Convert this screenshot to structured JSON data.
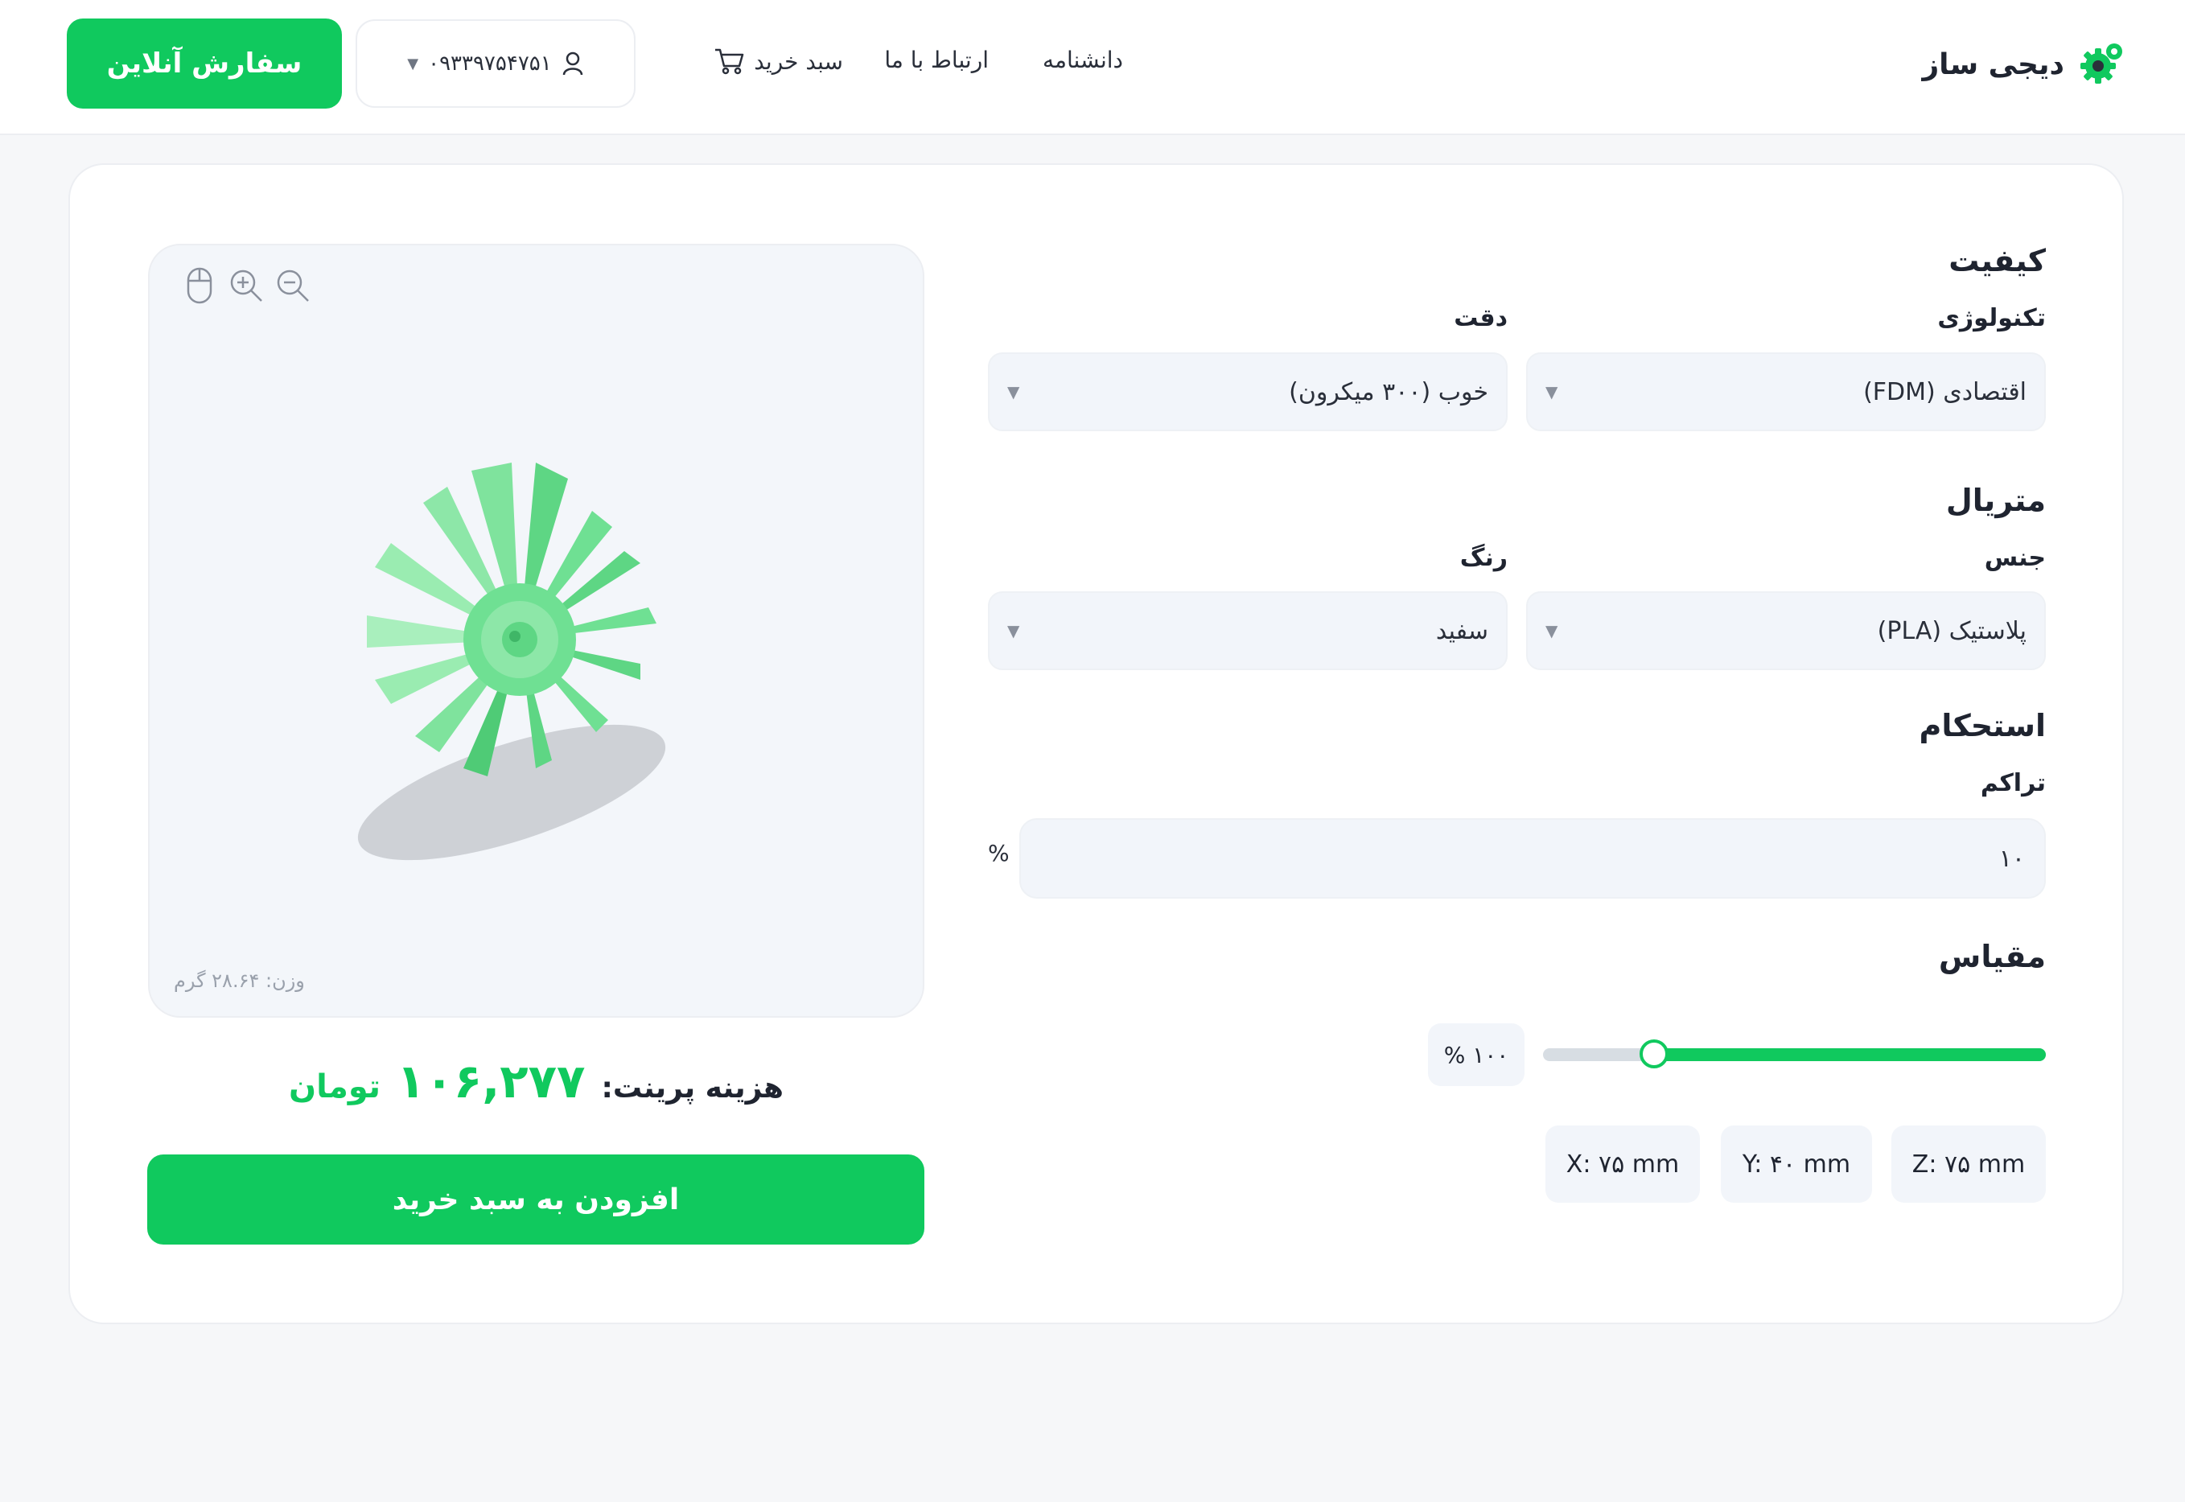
{
  "header": {
    "logo_text": "دیجی ساز",
    "nav": {
      "knowledge": "دانشنامه",
      "contact": "ارتباط با ما",
      "cart": "سبد خرید"
    },
    "phone": "۰۹۳۳۹۷۵۴۷۵۱",
    "order_button": "سفارش آنلاین"
  },
  "colors": {
    "brand_green": "#10c95e",
    "panel_bg": "#f3f6fa",
    "text_dark": "#1f2430"
  },
  "preview": {
    "tools": [
      "mouse-icon",
      "zoom-in-icon",
      "zoom-out-icon"
    ],
    "weight_text": "وزن: ۲۸.۶۴ گرم"
  },
  "price": {
    "label": "هزینه پرینت:",
    "value": "۱۰۶,۲۷۷",
    "unit": "تومان"
  },
  "add_to_cart": "افزودن به سبد خرید",
  "form": {
    "quality": {
      "title": "کیفیت",
      "technology_label": "تکنولوژی",
      "technology_value": "اقتصادی (FDM)",
      "precision_label": "دقت",
      "precision_value": "خوب (۳۰۰ میکرون)"
    },
    "material": {
      "title": "متریال",
      "type_label": "جنس",
      "type_value": "پلاستیک (PLA)",
      "color_label": "رنگ",
      "color_value": "سفید"
    },
    "strength": {
      "title": "استحکام",
      "density_label": "تراکم",
      "density_value": "۱۰",
      "density_unit": "%"
    },
    "scale": {
      "title": "مقیاس",
      "value_text": "۱۰۰ %",
      "level_fraction": 0.78
    },
    "dimensions": {
      "x": "X: ۷۵ mm",
      "y": "Y: ۴۰ mm",
      "z": "Z: ۷۵ mm"
    }
  }
}
